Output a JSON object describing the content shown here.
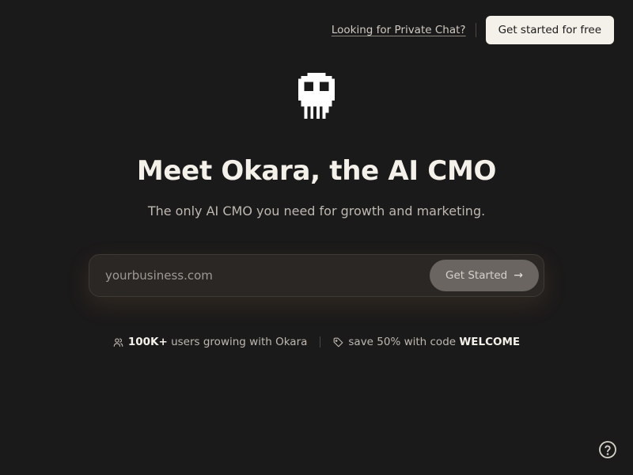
{
  "nav": {
    "private_chat_link": "Looking for Private Chat?",
    "cta_label": "Get started for free"
  },
  "logo": {
    "icon": "pixel-skull-logo-icon"
  },
  "hero": {
    "headline": "Meet Okara, the AI CMO",
    "subheadline": "The only AI CMO you need for growth and marketing."
  },
  "form": {
    "placeholder": "yourbusiness.com",
    "button_label": "Get Started",
    "button_icon": "→"
  },
  "stats": {
    "users_count": "100K+",
    "users_text": "users growing with Okara",
    "promo_prefix": "save 50% with code",
    "promo_code": "WELCOME"
  },
  "help": {
    "icon": "question-circle-icon"
  },
  "colors": {
    "background": "#1b1a1a",
    "primary_text": "#f4f1ea",
    "secondary_text": "#bdb8b1",
    "cta_background": "#f4f1ea",
    "input_background": "#2a2725",
    "button_background": "#6a6560"
  }
}
